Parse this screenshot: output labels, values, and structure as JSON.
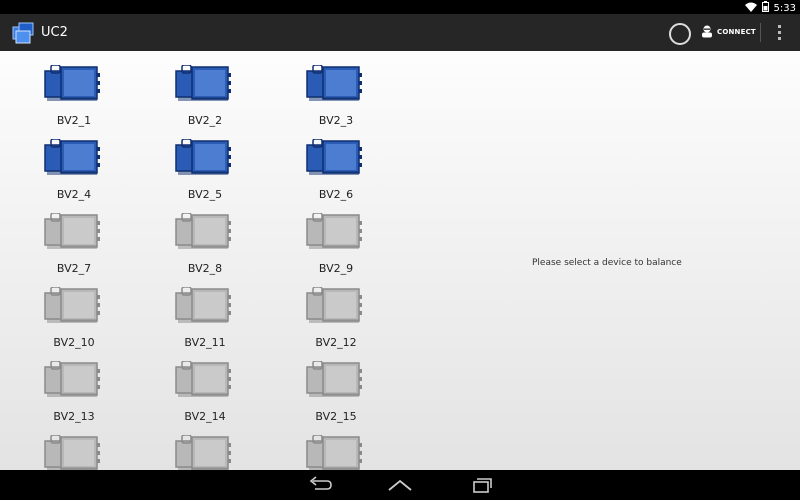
{
  "status_bar": {
    "time": "5:33",
    "icons": [
      "wifi-icon",
      "battery-icon"
    ]
  },
  "action_bar": {
    "title": "UC2",
    "app_icon": "device-cube-icon",
    "connect_label": "CONNECT",
    "connect_icon": "user-icon",
    "overflow_icon": "more-vertical-icon"
  },
  "devices": [
    {
      "name": "BV2_1",
      "state": "active"
    },
    {
      "name": "BV2_2",
      "state": "active"
    },
    {
      "name": "BV2_3",
      "state": "active"
    },
    {
      "name": "BV2_4",
      "state": "active"
    },
    {
      "name": "BV2_5",
      "state": "active"
    },
    {
      "name": "BV2_6",
      "state": "active"
    },
    {
      "name": "BV2_7",
      "state": "inactive"
    },
    {
      "name": "BV2_8",
      "state": "inactive"
    },
    {
      "name": "BV2_9",
      "state": "inactive"
    },
    {
      "name": "BV2_10",
      "state": "inactive"
    },
    {
      "name": "BV2_11",
      "state": "inactive"
    },
    {
      "name": "BV2_12",
      "state": "inactive"
    },
    {
      "name": "BV2_13",
      "state": "inactive"
    },
    {
      "name": "BV2_14",
      "state": "inactive"
    },
    {
      "name": "BV2_15",
      "state": "inactive"
    },
    {
      "name": "",
      "state": "inactive"
    },
    {
      "name": "",
      "state": "inactive"
    },
    {
      "name": "",
      "state": "inactive"
    }
  ],
  "detail": {
    "message": "Please select a device to balance"
  },
  "nav_bar": {
    "buttons": [
      "back-icon",
      "home-icon",
      "recent-apps-icon"
    ]
  },
  "colors": {
    "active": "#2a5bb5",
    "inactive": "#b8b8b8",
    "action_bar": "#262626"
  }
}
